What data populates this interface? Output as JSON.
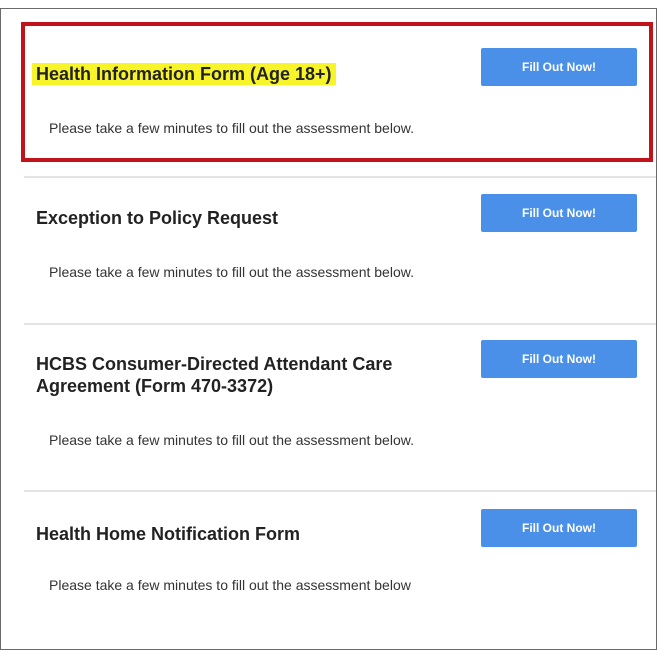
{
  "forms": [
    {
      "title": "Health Information Form (Age 18+)",
      "description": "Please take a few minutes to fill out the assessment below.",
      "button_label": "Fill Out Now!",
      "highlighted": true
    },
    {
      "title": "Exception to Policy Request",
      "description": "Please take a few minutes to fill out the assessment below.",
      "button_label": "Fill Out Now!",
      "highlighted": false
    },
    {
      "title": "HCBS Consumer-Directed Attendant Care Agreement (Form 470-3372)",
      "description": "Please take a few minutes to fill out the assessment below.",
      "button_label": "Fill Out Now!",
      "highlighted": false
    },
    {
      "title": "Health Home Notification Form",
      "description": "Please take a few minutes to fill out the assessment below",
      "button_label": "Fill Out Now!",
      "highlighted": false
    }
  ],
  "colors": {
    "button": "#4a90e8",
    "highlight_text": "#f7f52a",
    "highlight_border": "#c0141a",
    "divider": "#e4e4e4"
  }
}
